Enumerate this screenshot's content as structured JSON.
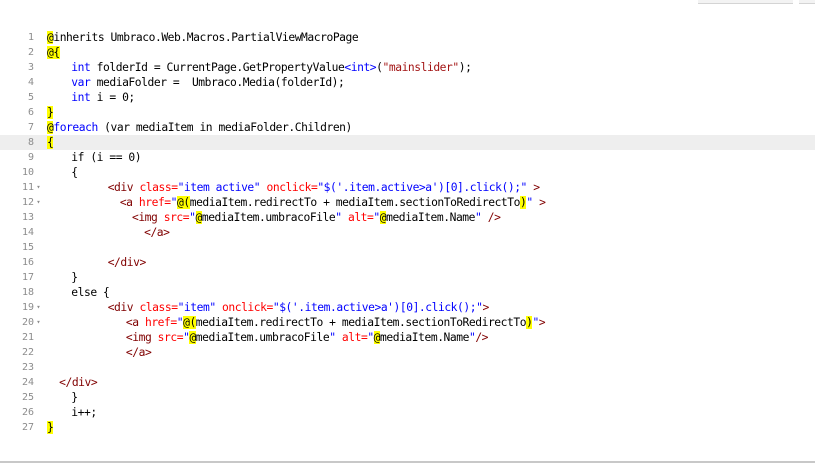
{
  "lines": [
    {
      "num": "1",
      "fold": false,
      "current": false,
      "indent": 0,
      "segs": [
        {
          "t": "@",
          "c": "hl"
        },
        {
          "t": "inherits Umbraco.Web.Macros.PartialViewMacroPage",
          "c": ""
        }
      ]
    },
    {
      "num": "2",
      "fold": false,
      "current": false,
      "indent": 0,
      "segs": [
        {
          "t": "@{",
          "c": "hl"
        }
      ]
    },
    {
      "num": "3",
      "fold": false,
      "current": false,
      "indent": 4,
      "segs": [
        {
          "t": "int",
          "c": "kw"
        },
        {
          "t": " folderId = CurrentPage.GetPropertyValue",
          "c": ""
        },
        {
          "t": "<int>",
          "c": "kw"
        },
        {
          "t": "(",
          "c": ""
        },
        {
          "t": "\"mainslider\"",
          "c": "str"
        },
        {
          "t": ");",
          "c": ""
        }
      ]
    },
    {
      "num": "4",
      "fold": false,
      "current": false,
      "indent": 4,
      "segs": [
        {
          "t": "var",
          "c": "kw"
        },
        {
          "t": " mediaFolder =  Umbraco.Media(folderId);",
          "c": ""
        }
      ]
    },
    {
      "num": "5",
      "fold": false,
      "current": false,
      "indent": 4,
      "segs": [
        {
          "t": "int",
          "c": "kw"
        },
        {
          "t": " i = 0;",
          "c": ""
        }
      ]
    },
    {
      "num": "6",
      "fold": false,
      "current": false,
      "indent": 0,
      "segs": [
        {
          "t": "}",
          "c": "hl"
        }
      ]
    },
    {
      "num": "7",
      "fold": false,
      "current": false,
      "indent": 0,
      "segs": [
        {
          "t": "@",
          "c": "hl"
        },
        {
          "t": "foreach",
          "c": "kw"
        },
        {
          "t": " (var mediaItem in mediaFolder.Children)",
          "c": ""
        }
      ]
    },
    {
      "num": "8",
      "fold": false,
      "current": true,
      "indent": 0,
      "segs": [
        {
          "t": "{",
          "c": "hl"
        }
      ]
    },
    {
      "num": "9",
      "fold": false,
      "current": false,
      "indent": 4,
      "segs": [
        {
          "t": "if (i == 0)",
          "c": ""
        }
      ]
    },
    {
      "num": "10",
      "fold": false,
      "current": false,
      "indent": 4,
      "segs": [
        {
          "t": "{",
          "c": ""
        }
      ]
    },
    {
      "num": "11",
      "fold": true,
      "current": false,
      "indent": 10,
      "segs": [
        {
          "t": "<div",
          "c": "tag"
        },
        {
          "t": " ",
          "c": ""
        },
        {
          "t": "class=",
          "c": "attr"
        },
        {
          "t": "\"item active\"",
          "c": "kw"
        },
        {
          "t": " ",
          "c": ""
        },
        {
          "t": "onclick=",
          "c": "attr"
        },
        {
          "t": "\"$('.item.active>a')[0].click();\"",
          "c": "kw"
        },
        {
          "t": " >",
          "c": "tag"
        }
      ]
    },
    {
      "num": "12",
      "fold": true,
      "current": false,
      "indent": 12,
      "segs": [
        {
          "t": "<a",
          "c": "tag"
        },
        {
          "t": " ",
          "c": ""
        },
        {
          "t": "href=",
          "c": "attr"
        },
        {
          "t": "\"",
          "c": "kw"
        },
        {
          "t": "@(",
          "c": "hl"
        },
        {
          "t": "mediaItem.redirectTo + mediaItem.sectionToRedirectTo",
          "c": ""
        },
        {
          "t": ")",
          "c": "hl"
        },
        {
          "t": "\"",
          "c": "kw"
        },
        {
          "t": " >",
          "c": "tag"
        }
      ]
    },
    {
      "num": "13",
      "fold": false,
      "current": false,
      "indent": 14,
      "segs": [
        {
          "t": "<img",
          "c": "tag"
        },
        {
          "t": " ",
          "c": ""
        },
        {
          "t": "src=",
          "c": "attr"
        },
        {
          "t": "\"",
          "c": "kw"
        },
        {
          "t": "@",
          "c": "hl"
        },
        {
          "t": "mediaItem.umbracoFile",
          "c": ""
        },
        {
          "t": "\"",
          "c": "kw"
        },
        {
          "t": " ",
          "c": ""
        },
        {
          "t": "alt=",
          "c": "attr"
        },
        {
          "t": "\"",
          "c": "kw"
        },
        {
          "t": "@",
          "c": "hl"
        },
        {
          "t": "mediaItem.Name",
          "c": ""
        },
        {
          "t": "\"",
          "c": "kw"
        },
        {
          "t": " />",
          "c": "tag"
        }
      ]
    },
    {
      "num": "14",
      "fold": false,
      "current": false,
      "indent": 16,
      "segs": [
        {
          "t": "</a>",
          "c": "tag"
        }
      ]
    },
    {
      "num": "15",
      "fold": false,
      "current": false,
      "indent": 0,
      "segs": []
    },
    {
      "num": "16",
      "fold": false,
      "current": false,
      "indent": 10,
      "segs": [
        {
          "t": "</div>",
          "c": "tag"
        }
      ]
    },
    {
      "num": "17",
      "fold": false,
      "current": false,
      "indent": 4,
      "segs": [
        {
          "t": "}",
          "c": ""
        }
      ]
    },
    {
      "num": "18",
      "fold": false,
      "current": false,
      "indent": 4,
      "segs": [
        {
          "t": "else {",
          "c": ""
        }
      ]
    },
    {
      "num": "19",
      "fold": true,
      "current": false,
      "indent": 10,
      "segs": [
        {
          "t": "<div",
          "c": "tag"
        },
        {
          "t": " ",
          "c": ""
        },
        {
          "t": "class=",
          "c": "attr"
        },
        {
          "t": "\"item\"",
          "c": "kw"
        },
        {
          "t": " ",
          "c": ""
        },
        {
          "t": "onclick=",
          "c": "attr"
        },
        {
          "t": "\"$('.item.active>a')[0].click();\"",
          "c": "kw"
        },
        {
          "t": ">",
          "c": "tag"
        }
      ]
    },
    {
      "num": "20",
      "fold": true,
      "current": false,
      "indent": 13,
      "segs": [
        {
          "t": "<a",
          "c": "tag"
        },
        {
          "t": " ",
          "c": ""
        },
        {
          "t": "href=",
          "c": "attr"
        },
        {
          "t": "\"",
          "c": "kw"
        },
        {
          "t": "@(",
          "c": "hl"
        },
        {
          "t": "mediaItem.redirectTo + mediaItem.sectionToRedirectTo",
          "c": ""
        },
        {
          "t": ")",
          "c": "hl"
        },
        {
          "t": "\"",
          "c": "kw"
        },
        {
          "t": ">",
          "c": "tag"
        }
      ]
    },
    {
      "num": "21",
      "fold": false,
      "current": false,
      "indent": 13,
      "segs": [
        {
          "t": "<img",
          "c": "tag"
        },
        {
          "t": " ",
          "c": ""
        },
        {
          "t": "src=",
          "c": "attr"
        },
        {
          "t": "\"",
          "c": "kw"
        },
        {
          "t": "@",
          "c": "hl"
        },
        {
          "t": "mediaItem.umbracoFile",
          "c": ""
        },
        {
          "t": "\"",
          "c": "kw"
        },
        {
          "t": " ",
          "c": ""
        },
        {
          "t": "alt=",
          "c": "attr"
        },
        {
          "t": "\"",
          "c": "kw"
        },
        {
          "t": "@",
          "c": "hl"
        },
        {
          "t": "mediaItem.Name",
          "c": ""
        },
        {
          "t": "\"",
          "c": "kw"
        },
        {
          "t": "/>",
          "c": "tag"
        }
      ]
    },
    {
      "num": "22",
      "fold": false,
      "current": false,
      "indent": 13,
      "segs": [
        {
          "t": "</a>",
          "c": "tag"
        }
      ]
    },
    {
      "num": "23",
      "fold": false,
      "current": false,
      "indent": 0,
      "segs": []
    },
    {
      "num": "24",
      "fold": false,
      "current": false,
      "indent": 2,
      "segs": [
        {
          "t": "</div>",
          "c": "tag"
        }
      ]
    },
    {
      "num": "25",
      "fold": false,
      "current": false,
      "indent": 4,
      "segs": [
        {
          "t": "}",
          "c": ""
        }
      ]
    },
    {
      "num": "26",
      "fold": false,
      "current": false,
      "indent": 4,
      "segs": [
        {
          "t": "i++;",
          "c": ""
        }
      ]
    },
    {
      "num": "27",
      "fold": false,
      "current": false,
      "indent": 0,
      "segs": [
        {
          "t": "}",
          "c": "hl"
        }
      ]
    }
  ]
}
